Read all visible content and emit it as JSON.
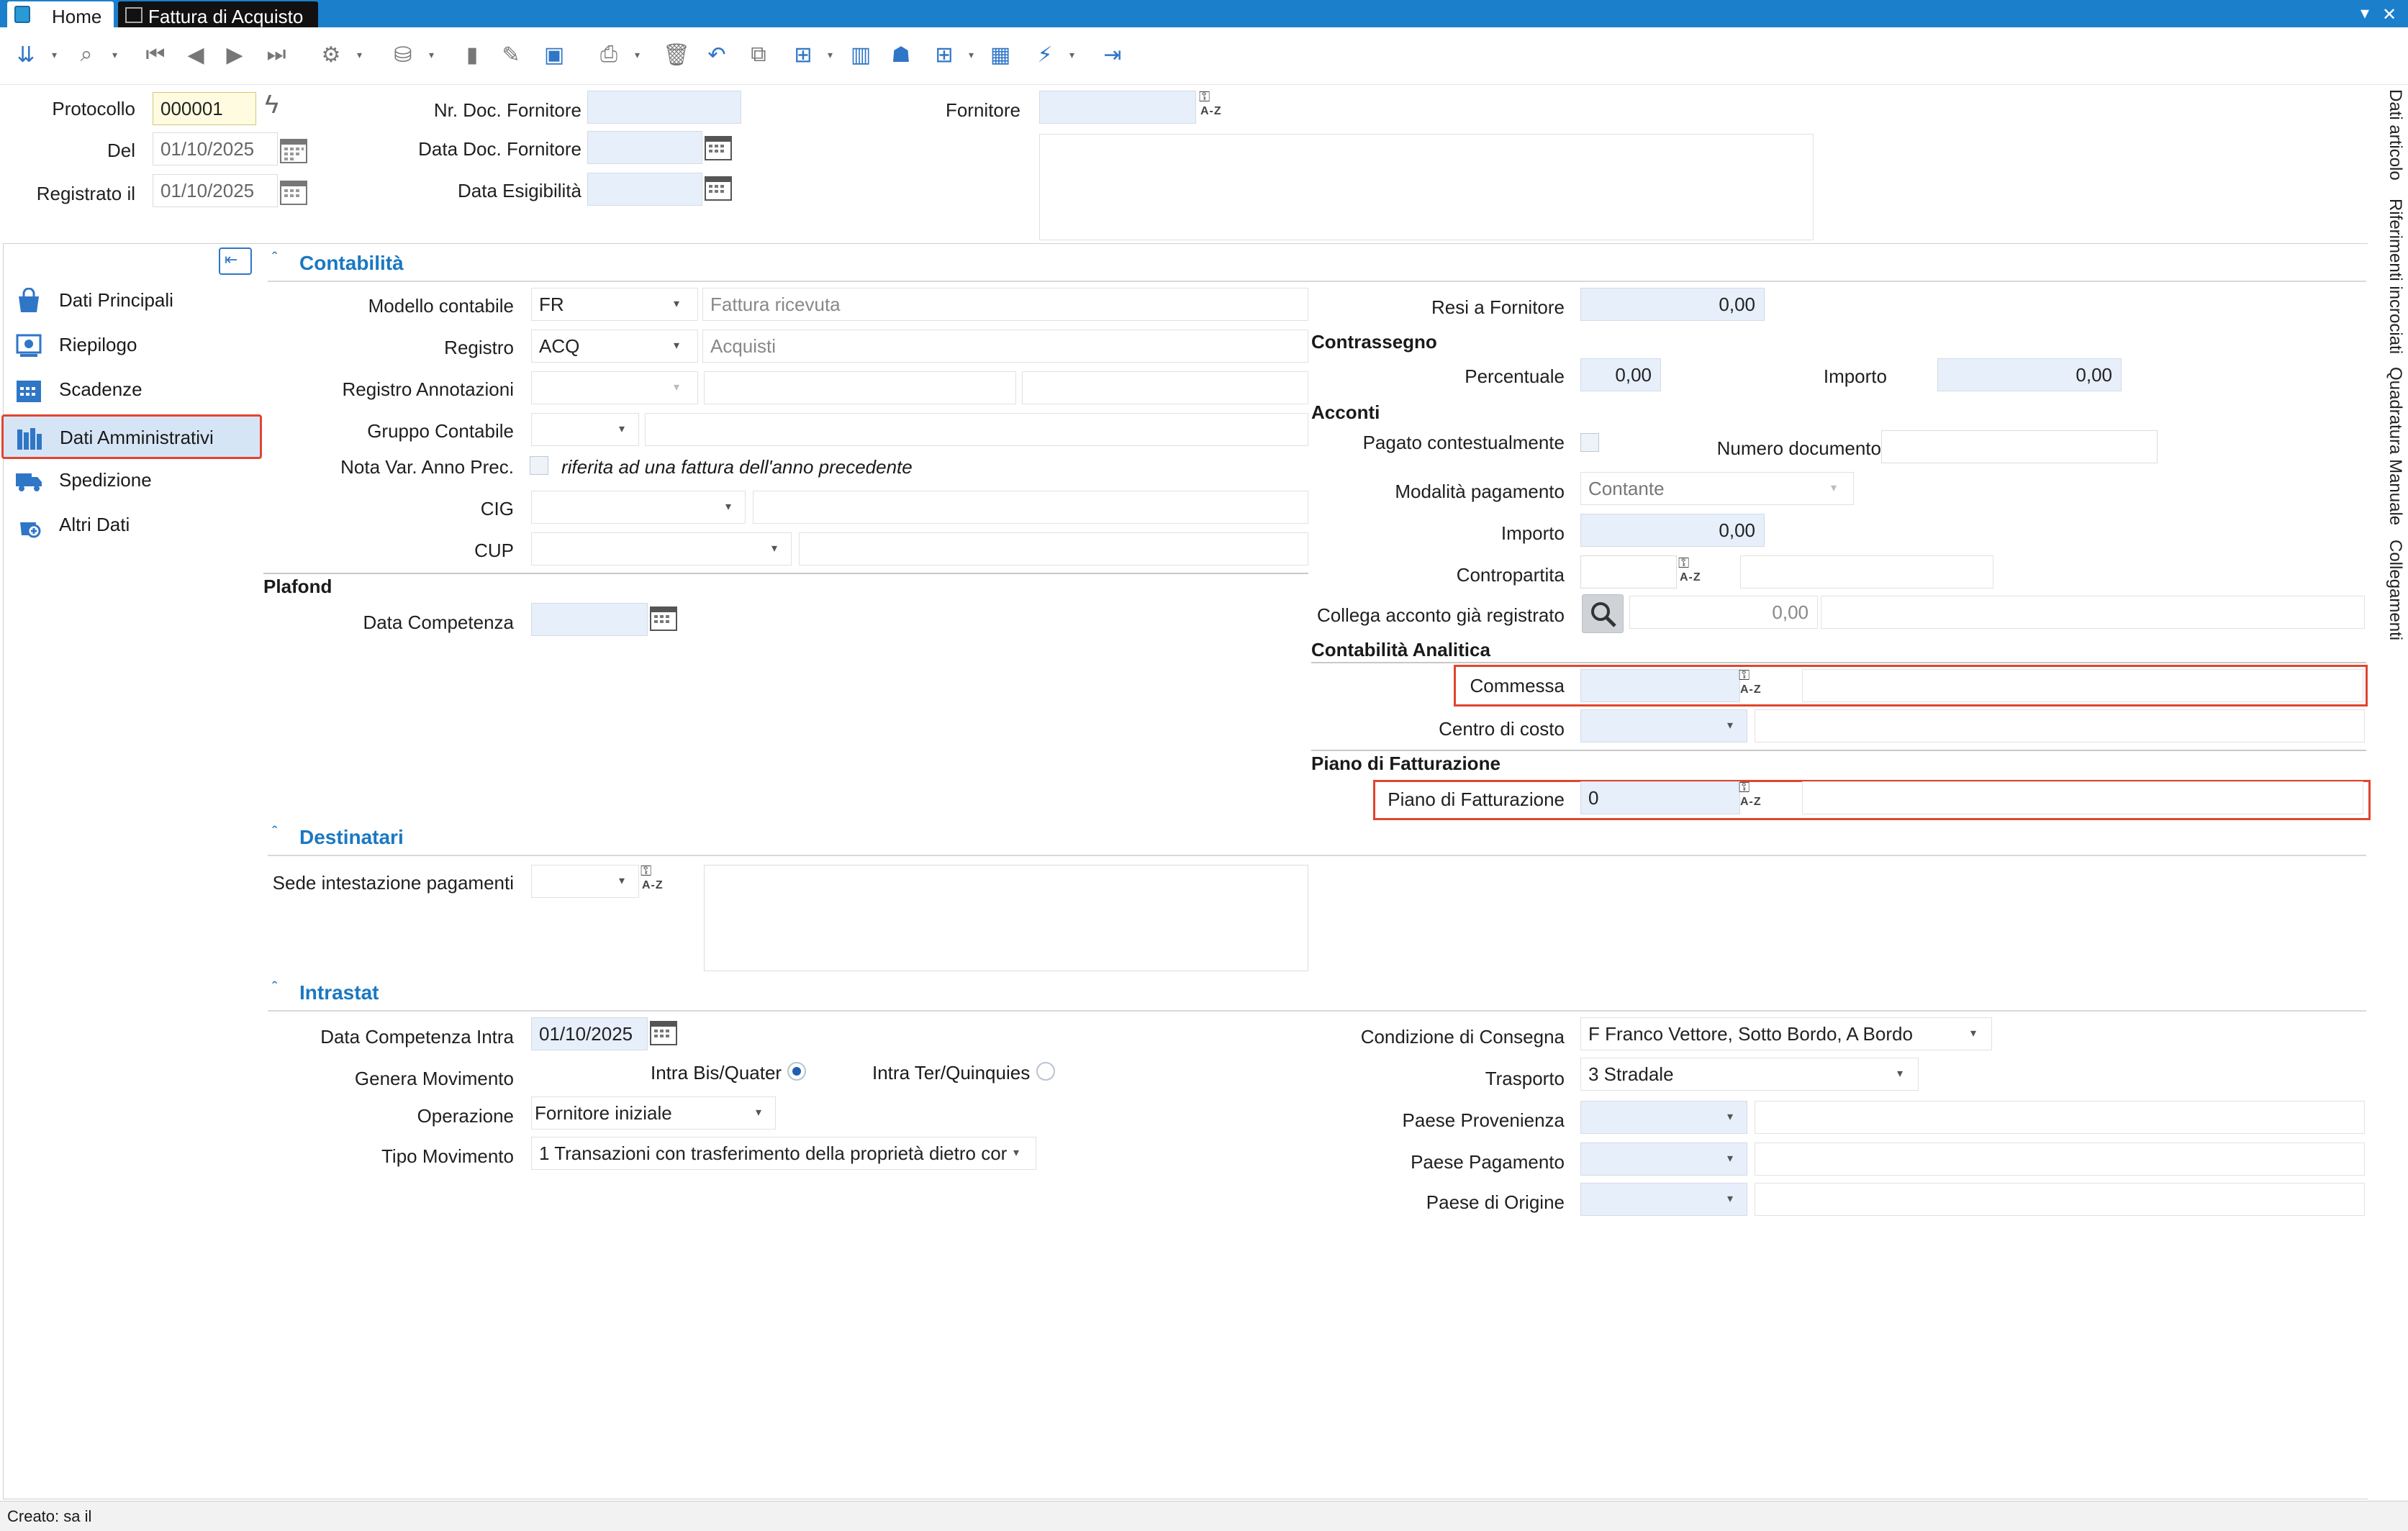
{
  "titlebar": {
    "tabs": [
      {
        "label": "Home"
      },
      {
        "label": "Fattura di Acquisto"
      }
    ],
    "min_icon": "▾",
    "close_icon": "✕"
  },
  "header": {
    "protocollo_label": "Protocollo",
    "protocollo_value": "000001",
    "del_label": "Del",
    "del_value": "01/10/2025",
    "registrato_label": "Registrato il",
    "registrato_value": "01/10/2025",
    "nr_doc_label": "Nr. Doc. Fornitore",
    "nr_doc_value": "",
    "data_doc_label": "Data Doc. Fornitore",
    "data_doc_value": "",
    "data_esig_label": "Data Esigibilità",
    "data_esig_value": "",
    "fornitore_label": "Fornitore",
    "fornitore_value": ""
  },
  "right_tabs": [
    "Dati articolo",
    "Riferimenti incrociati",
    "Quadratura Manuale",
    "Collegamenti"
  ],
  "sidebar": {
    "items": [
      {
        "label": "Dati Principali",
        "active": false
      },
      {
        "label": "Riepilogo",
        "active": false
      },
      {
        "label": "Scadenze",
        "active": false
      },
      {
        "label": "Dati Amministrativi",
        "active": true
      },
      {
        "label": "Spedizione",
        "active": false
      },
      {
        "label": "Altri Dati",
        "active": false
      }
    ]
  },
  "contabilita": {
    "title": "Contabilità",
    "modello_label": "Modello contabile",
    "modello_code": "FR",
    "modello_desc": "Fattura ricevuta",
    "registro_label": "Registro",
    "registro_code": "ACQ",
    "registro_desc": "Acquisti",
    "reg_annot_label": "Registro Annotazioni",
    "reg_annot_value": "",
    "gruppo_label": "Gruppo Contabile",
    "gruppo_value": "",
    "nota_label": "Nota Var. Anno Prec.",
    "nota_text": "riferita ad una fattura dell'anno precedente",
    "cig_label": "CIG",
    "cup_label": "CUP",
    "plafond_title": "Plafond",
    "data_comp_label": "Data Competenza",
    "data_comp_value": "",
    "resi_label": "Resi a Fornitore",
    "resi_value": "0,00",
    "contrassegno_title": "Contrassegno",
    "percentuale_label": "Percentuale",
    "percentuale_value": "0,00",
    "importo_c_label": "Importo",
    "importo_c_value": "0,00",
    "acconti_title": "Acconti",
    "pagato_label": "Pagato contestualmente",
    "numdoc_label": "Numero documento",
    "numdoc_value": "",
    "modalita_label": "Modalità pagamento",
    "modalita_value": "Contante",
    "importo_a_label": "Importo",
    "importo_a_value": "0,00",
    "contropartita_label": "Contropartita",
    "collega_label": "Collega acconto già registrato",
    "collega_value": "0,00",
    "analitica_title": "Contabilità Analitica",
    "commessa_label": "Commessa",
    "commessa_value": "",
    "centro_label": "Centro di costo",
    "piano_title": "Piano di Fatturazione",
    "piano_label": "Piano di Fatturazione",
    "piano_value": "0"
  },
  "destinatari": {
    "title": "Destinatari",
    "sede_label": "Sede intestazione pagamenti"
  },
  "intrastat": {
    "title": "Intrastat",
    "data_comp_label": "Data Competenza Intra",
    "data_comp_value": "01/10/2025",
    "genera_label": "Genera Movimento",
    "bis_label": "Intra Bis/Quater",
    "ter_label": "Intra Ter/Quinquies",
    "operazione_label": "Operazione",
    "operazione_value": "Fornitore iniziale",
    "tipo_label": "Tipo Movimento",
    "tipo_value": "1  Transazioni con trasferimento della proprietà dietro cor",
    "condizione_label": "Condizione di Consegna",
    "condizione_value": "F  Franco Vettore, Sotto Bordo, A Bordo",
    "trasporto_label": "Trasporto",
    "trasporto_value": "3 Stradale",
    "paese_prov_label": "Paese Provenienza",
    "paese_pag_label": "Paese Pagamento",
    "paese_orig_label": "Paese di Origine"
  },
  "status": {
    "text": "Creato: sa il"
  },
  "colors": {
    "accent": "#1a78c2",
    "highlight_border": "#e0452f",
    "titlebar": "#1b7fcb"
  }
}
